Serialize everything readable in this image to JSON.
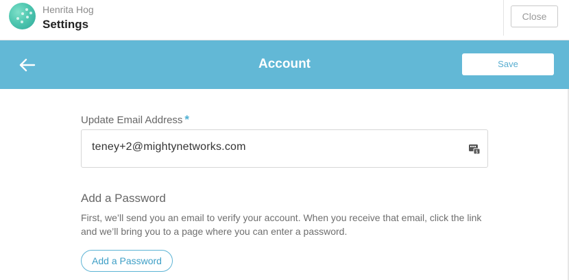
{
  "topbar": {
    "network_name": "Henrita Hog",
    "page_title": "Settings",
    "close_label": "Close"
  },
  "header": {
    "title": "Account",
    "save_label": "Save"
  },
  "email": {
    "label": "Update Email Address",
    "required_mark": "*",
    "value": "teney+2@mightynetworks.com"
  },
  "password": {
    "title": "Add a Password",
    "description": "First, we’ll send you an email to verify your account. When you receive that email, click the link and we’ll bring you to a page where you can enter a password.",
    "button_label": "Add a Password"
  },
  "colors": {
    "accent": "#62b8d6",
    "button_text": "#3e9fc6"
  },
  "icons": [
    "avatar-logo-icon",
    "back-arrow-icon",
    "autofill-card-icon"
  ]
}
